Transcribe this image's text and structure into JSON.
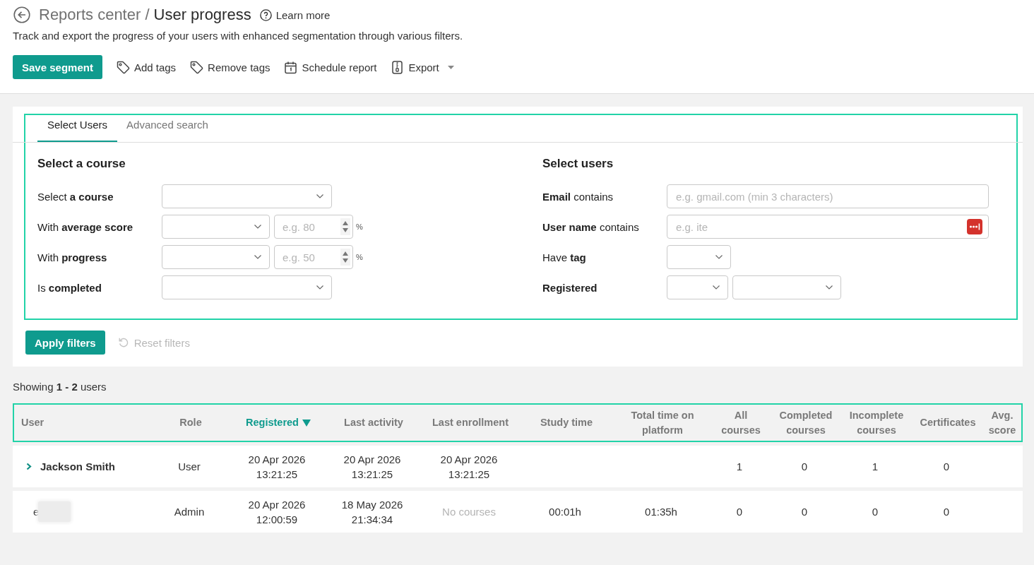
{
  "header": {
    "breadcrumb": "Reports center /",
    "title": "User progress",
    "help_link": "Learn more",
    "description": "Track and export the progress of your users with enhanced segmentation through various filters."
  },
  "toolbar": [
    {
      "kind": "primary",
      "label": "Save segment"
    },
    {
      "kind": "action",
      "label": "Add tags"
    },
    {
      "kind": "action",
      "label": "Remove tags"
    },
    {
      "kind": "action",
      "label": "Schedule report"
    },
    {
      "kind": "menu",
      "label": "Export"
    }
  ],
  "filters": {
    "highlighted": true,
    "tabs": [
      {
        "label": "Select Users",
        "selected": true
      },
      {
        "label": "Advanced search",
        "selected": false
      }
    ],
    "sections": [
      {
        "heading": "Select a course",
        "rows": [
          {
            "label": "Select **a course**",
            "bold": false,
            "controls": [
              {
                "kind": "select"
              }
            ]
          },
          {
            "label": "With **average score**",
            "bold": false,
            "controls": [
              {
                "kind": "select"
              },
              {
                "kind": "number",
                "placeholder": "e.g. 80",
                "unit": "%"
              }
            ]
          },
          {
            "label": "With **progress**",
            "bold": false,
            "controls": [
              {
                "kind": "select"
              },
              {
                "kind": "number",
                "placeholder": "e.g. 50",
                "unit": "%"
              }
            ]
          },
          {
            "label": "Is **completed**",
            "bold": false,
            "controls": [
              {
                "kind": "select"
              }
            ]
          }
        ]
      },
      {
        "heading": "Select users",
        "rows": [
          {
            "label": "**Email** contains",
            "bold": false,
            "controls": [
              {
                "kind": "text",
                "placeholder": "e.g. gmail.com (min 3 characters)",
                "autofill_badge": false
              }
            ]
          },
          {
            "label": "**User name** contains",
            "bold": false,
            "controls": [
              {
                "kind": "text",
                "placeholder": "e.g. ite",
                "autofill_badge": true
              }
            ]
          },
          {
            "label": "Have **tag**",
            "bold": false,
            "controls": [
              {
                "kind": "select"
              }
            ]
          },
          {
            "label": "Registered",
            "bold": true,
            "controls": [
              {
                "kind": "select"
              },
              {
                "kind": "select"
              }
            ]
          }
        ]
      }
    ]
  },
  "actions": {
    "apply": {
      "label": "Apply filters"
    },
    "reset": {
      "label": "Reset filters",
      "disabled": true
    }
  },
  "results_summary": "Showing **1 - 2** users",
  "table": {
    "header_highlighted": true,
    "columns": [
      {
        "label": "User",
        "sorted": false
      },
      {
        "label": "Role",
        "sorted": false
      },
      {
        "label": "Registered",
        "sorted": true
      },
      {
        "label": "Last activity",
        "sorted": false
      },
      {
        "label": "Last enrollment",
        "sorted": false
      },
      {
        "label": "Study time",
        "sorted": false
      },
      {
        "label": "Total time on platform",
        "sorted": false
      },
      {
        "label": "All courses",
        "sorted": false
      },
      {
        "label": "Completed courses",
        "sorted": false
      },
      {
        "label": "Incomplete courses",
        "sorted": false
      },
      {
        "label": "Certificates",
        "sorted": false
      },
      {
        "label": "Avg. score",
        "sorted": false
      }
    ],
    "rows": [
      {
        "user": {
          "name": "Jackson Smith",
          "expandable": true,
          "redacted": false
        },
        "role": "User",
        "registered": "20 Apr 2026\n13:21:25",
        "last_activity": "20 Apr 2026\n13:21:25",
        "last_enrollment": "20 Apr 2026\n13:21:25",
        "all_courses": "1",
        "completed_courses": "0",
        "incomplete_courses": "1",
        "certificates": "0"
      },
      {
        "user": {
          "name": "e",
          "expandable": false,
          "redacted": true
        },
        "role": "Admin",
        "registered": "20 Apr 2026\n12:00:59",
        "last_activity": "18 May 2026\n21:34:34",
        "last_enrollment": {
          "empty_note": "No courses"
        },
        "study_time": "00:01h",
        "total_time_on_platform": "01:35h",
        "all_courses": "0",
        "completed_courses": "0",
        "incomplete_courses": "0",
        "certificates": "0"
      }
    ]
  }
}
